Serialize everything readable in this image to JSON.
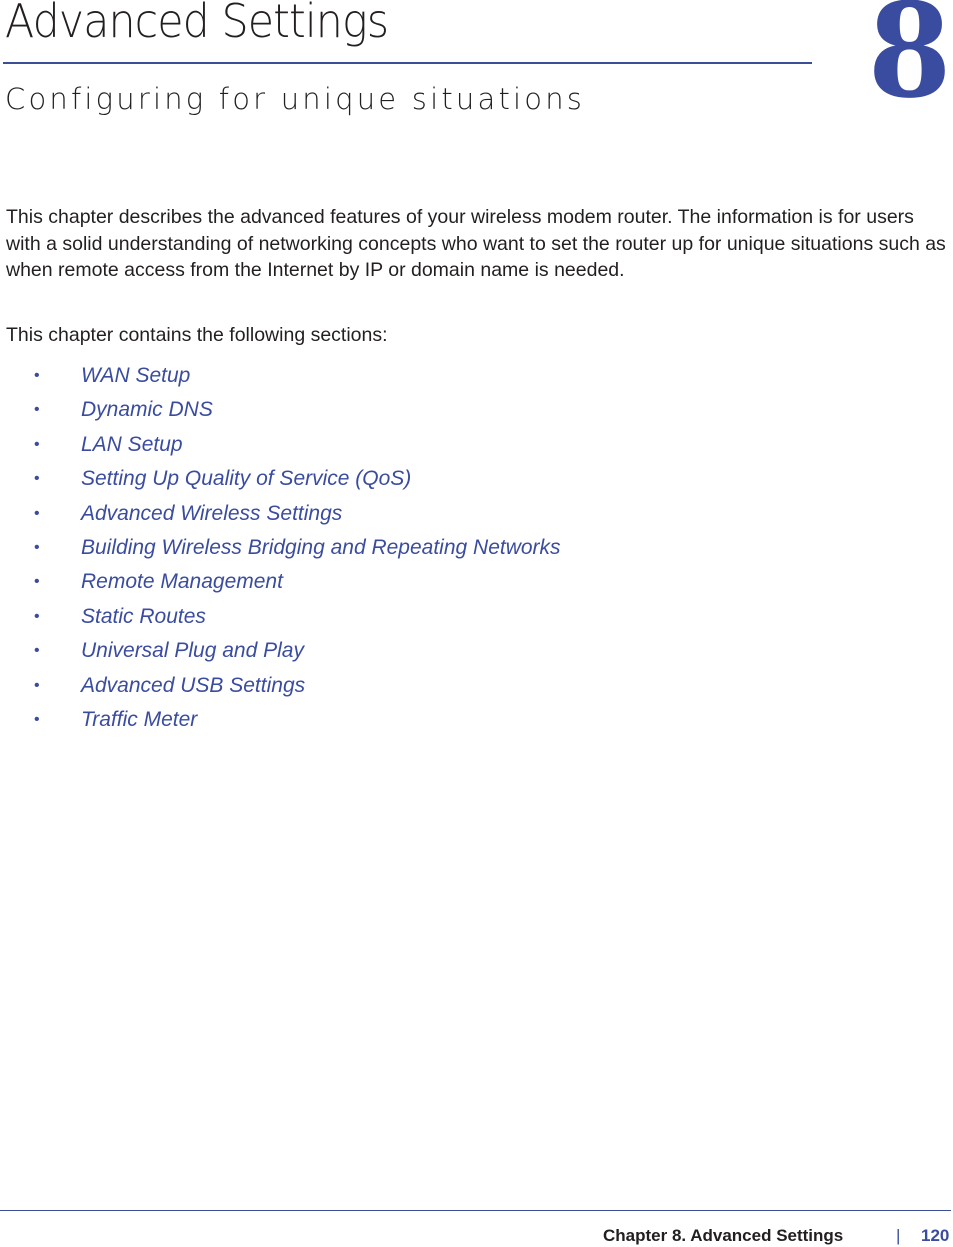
{
  "header": {
    "title": "Advanced Settings",
    "subtitle": "Configuring for unique situations",
    "chapter_number": "8"
  },
  "body": {
    "intro": "This chapter describes the advanced features of your wireless modem router. The information is for users with a solid understanding of networking concepts who want to set the router up for unique situations such as when remote access from the Internet by IP or domain name is needed.",
    "sections_intro": "This chapter contains the following sections:",
    "sections": [
      {
        "bullet": "•",
        "label": "WAN Setup"
      },
      {
        "bullet": "•",
        "label": "Dynamic DNS"
      },
      {
        "bullet": "•",
        "label": "LAN Setup"
      },
      {
        "bullet": "•",
        "label": "Setting Up Quality of Service (QoS)"
      },
      {
        "bullet": "•",
        "label": "Advanced Wireless Settings"
      },
      {
        "bullet": "•",
        "label": "Building Wireless Bridging and Repeating Networks"
      },
      {
        "bullet": "•",
        "label": "Remote Management"
      },
      {
        "bullet": "•",
        "label": "Static Routes"
      },
      {
        "bullet": "•",
        "label": "Universal Plug and Play"
      },
      {
        "bullet": "•",
        "label": "Advanced USB Settings"
      },
      {
        "bullet": "•",
        "label": "Traffic Meter"
      }
    ]
  },
  "footer": {
    "chapter_label": "Chapter 8.  Advanced Settings",
    "separator": "|",
    "page_number": "120"
  },
  "colors": {
    "accent": "#3a4c9f",
    "text": "#231f20"
  }
}
